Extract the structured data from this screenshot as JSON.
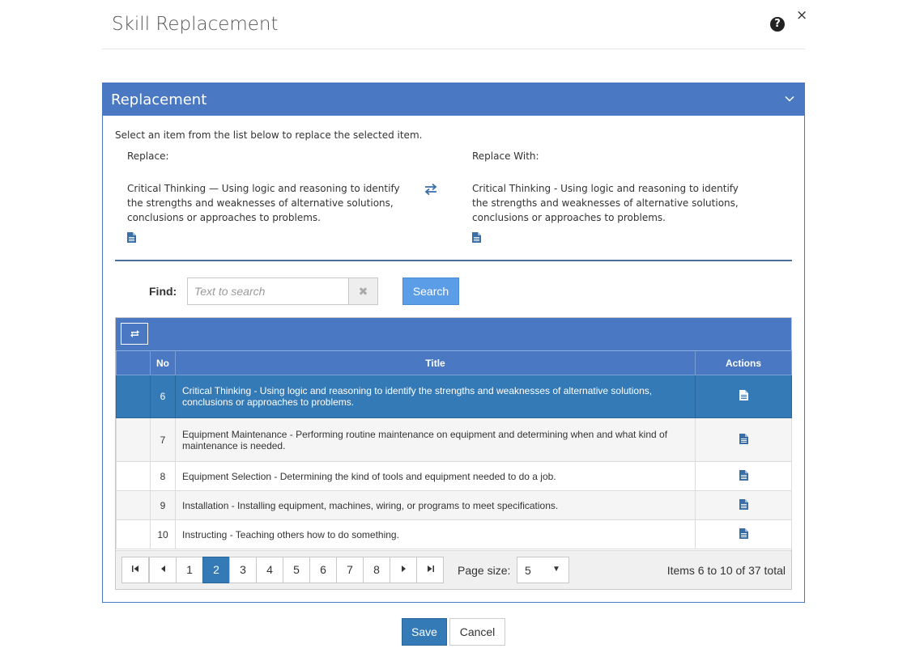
{
  "dialog": {
    "title": "Skill Replacement",
    "help_icon": "question-circle-icon",
    "close_glyph": "×"
  },
  "panel": {
    "title": "Replacement",
    "instruction": "Select an item from the list below to replace the selected item.",
    "replace_label": "Replace:",
    "replace_text": "Critical Thinking — Using logic and reasoning to identify the strengths and weaknesses of alternative solutions, conclusions or approaches to problems.",
    "replace_with_label": "Replace With:",
    "replace_with_text": "Critical Thinking - Using logic and reasoning to identify the strengths and weaknesses of alternative solutions, conclusions or approaches to problems."
  },
  "find": {
    "label": "Find:",
    "placeholder": "Text to search",
    "value": "",
    "clear_glyph": "✖",
    "search_label": "Search"
  },
  "grid": {
    "columns": {
      "no": "No",
      "title": "Title",
      "actions": "Actions"
    },
    "rows": [
      {
        "no": "6",
        "title": "Critical Thinking - Using logic and reasoning to identify the strengths and weaknesses of alternative solutions, conclusions or approaches to problems.",
        "selected": true
      },
      {
        "no": "7",
        "title": "Equipment Maintenance - Performing routine maintenance on equipment and determining when and what kind of maintenance is needed.",
        "selected": false
      },
      {
        "no": "8",
        "title": "Equipment Selection - Determining the kind of tools and equipment needed to do a job.",
        "selected": false
      },
      {
        "no": "9",
        "title": "Installation - Installing equipment, machines, wiring, or programs to meet specifications.",
        "selected": false
      },
      {
        "no": "10",
        "title": "Instructing - Teaching others how to do something.",
        "selected": false
      }
    ]
  },
  "pager": {
    "first_glyph": "⏮",
    "prev_glyph": "◀",
    "next_glyph": "▶",
    "last_glyph": "⏭",
    "pages": [
      "1",
      "2",
      "3",
      "4",
      "5",
      "6",
      "7",
      "8"
    ],
    "current_page": "2",
    "page_size_label": "Page size:",
    "page_size": "5",
    "caret": "▼",
    "items_info": "Items 6 to 10 of 37 total"
  },
  "footer": {
    "save_label": "Save",
    "cancel_label": "Cancel"
  },
  "colors": {
    "header_blue": "#4a78c2",
    "selected_row": "#337ab7",
    "search_button": "#5c9de8",
    "icon_blue": "#3a6ea8"
  }
}
